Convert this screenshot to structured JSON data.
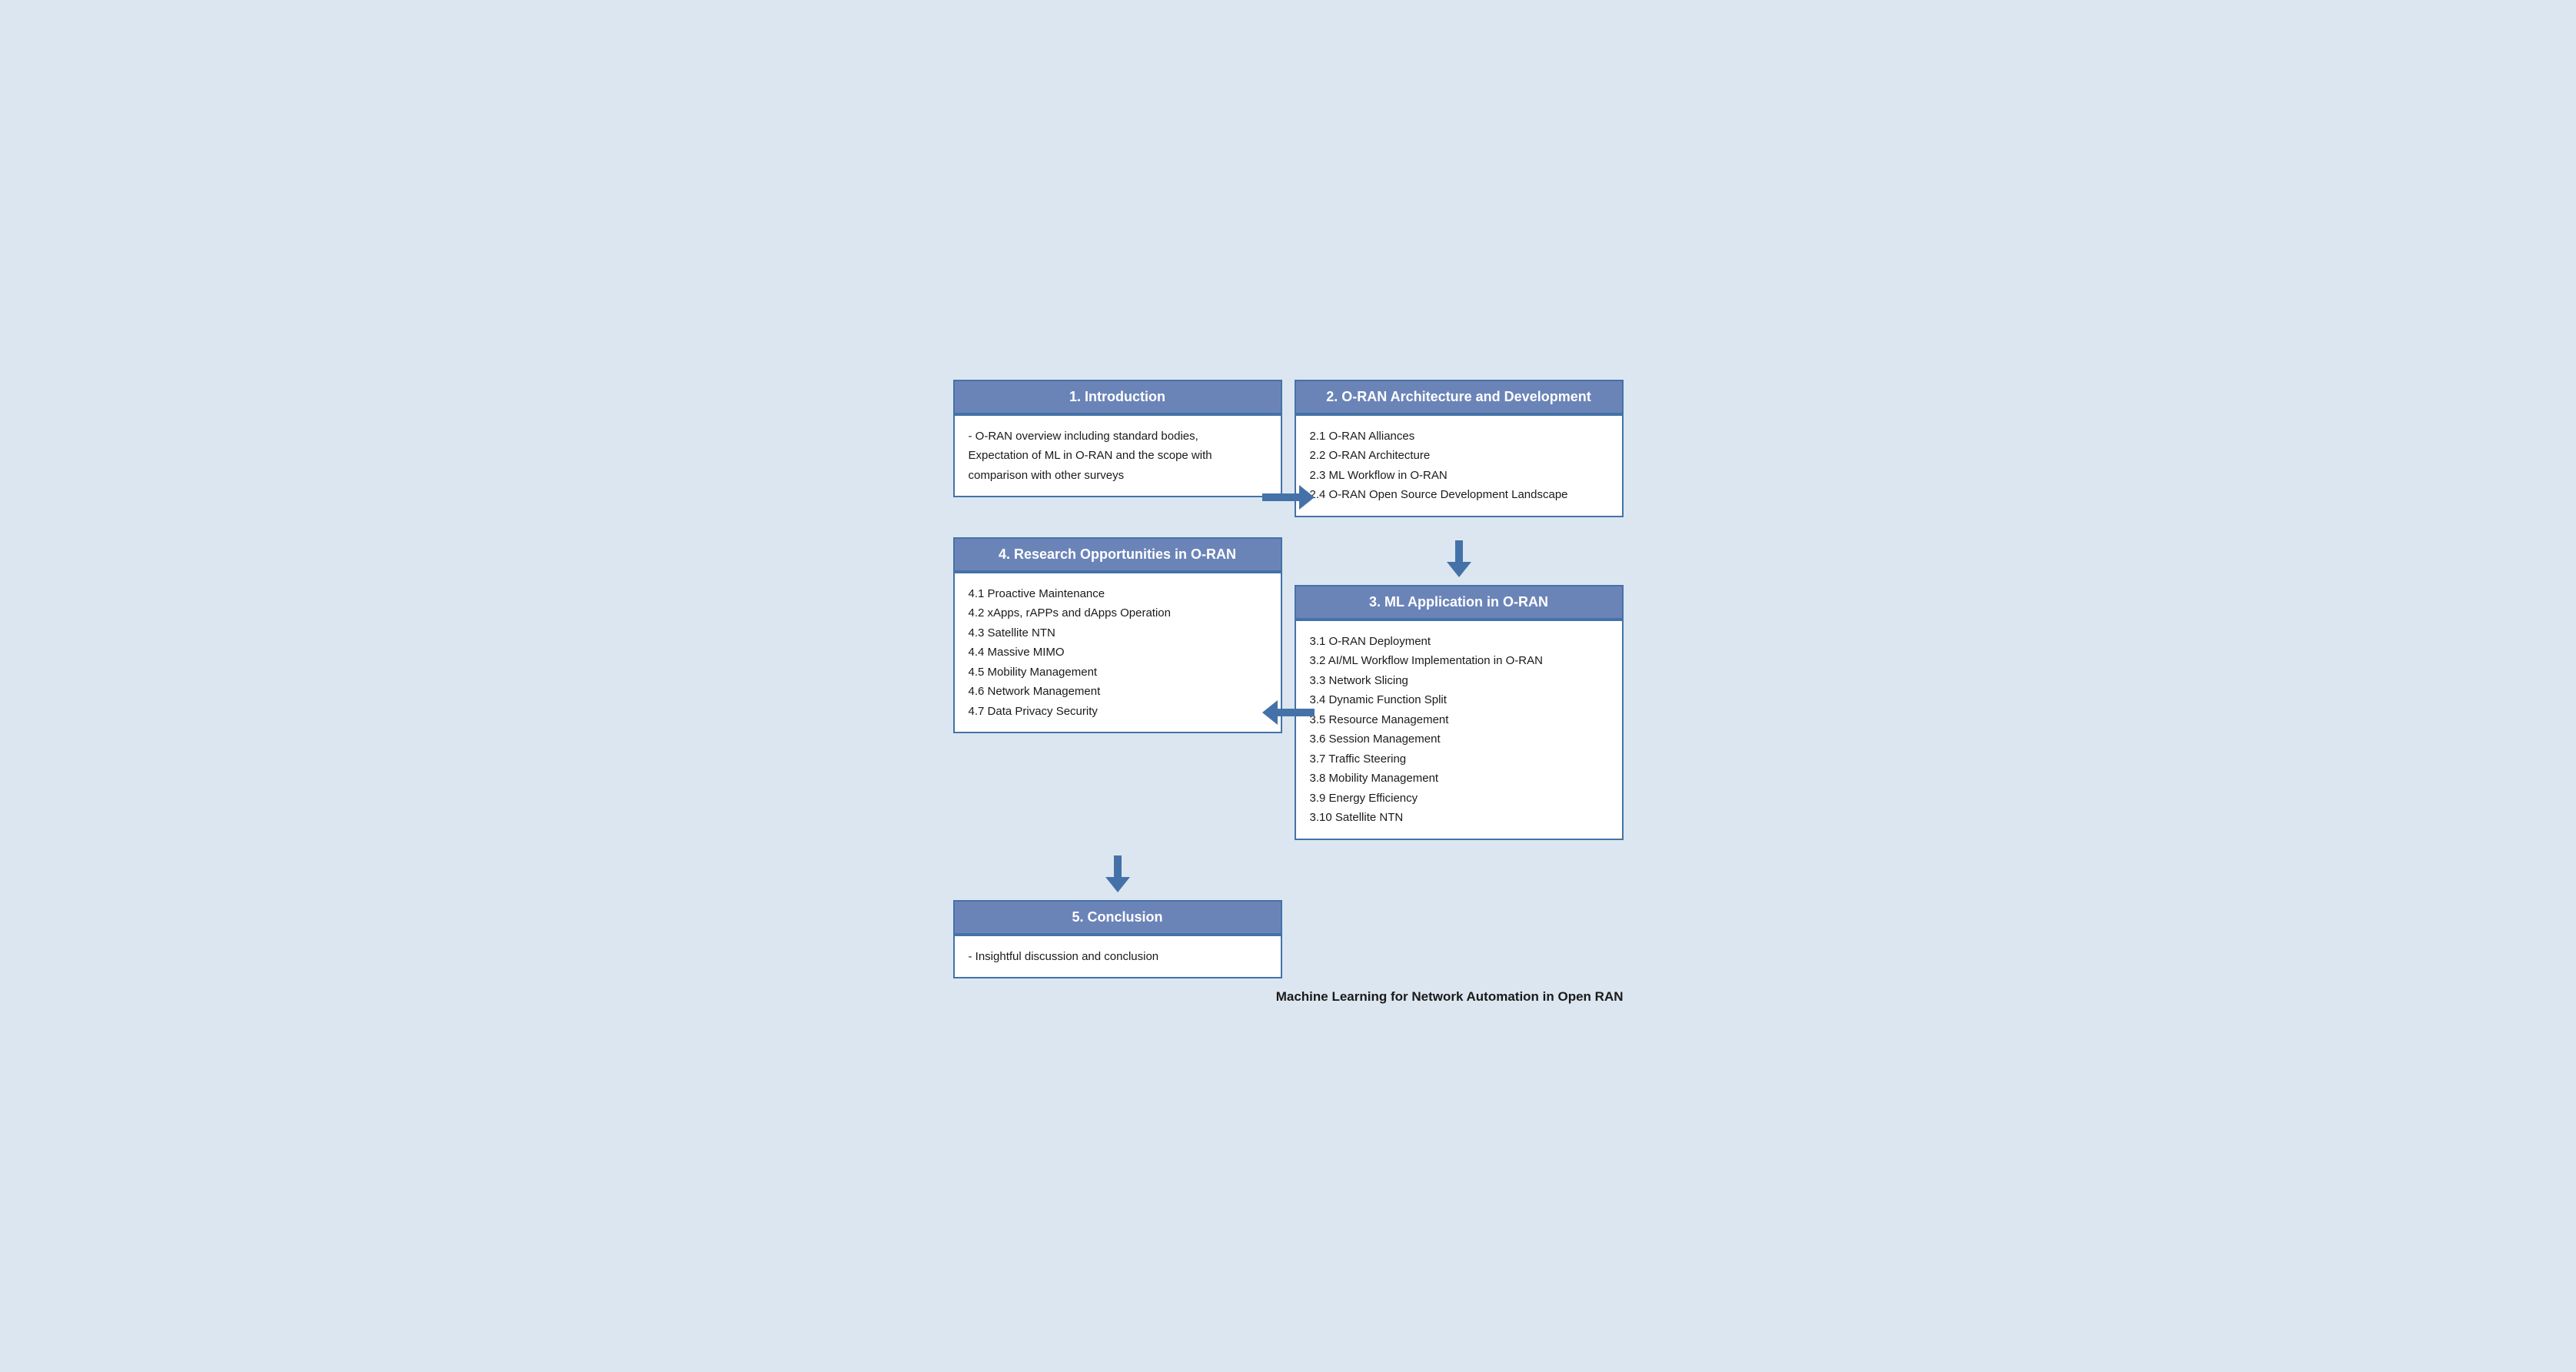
{
  "diagram": {
    "background_color": "#dce6f0",
    "border_color": "#4472a8",
    "header_bg": "#6b84b8",
    "sec1": {
      "title": "1.  Introduction",
      "body": "- O-RAN overview including standard bodies,\n  Expectation of ML in O-RAN and the scope with\n  comparison with other surveys"
    },
    "sec2": {
      "title": "2.  O-RAN Architecture and Development",
      "items": [
        "2.1  O-RAN Alliances",
        "2.2  O-RAN Architecture",
        "2.3  ML Workflow in O-RAN",
        "2.4  O-RAN Open Source Development Landscape"
      ]
    },
    "sec3": {
      "title": "3.  ML Application in O-RAN",
      "items": [
        "3.1  O-RAN Deployment",
        "3.2  AI/ML Workflow Implementation in O-RAN",
        "3.3  Network Slicing",
        "3.4  Dynamic Function Split",
        "3.5  Resource Management",
        "3.6  Session Management",
        "3.7  Traffic Steering",
        "3.8  Mobility Management",
        "3.9  Energy Efficiency",
        "3.10  Satellite NTN"
      ]
    },
    "sec4": {
      "title": "4.  Research Opportunities in O-RAN",
      "items": [
        "4.1  Proactive Maintenance",
        "4.2  xApps, rAPPs and dApps Operation",
        "4.3  Satellite NTN",
        "4.4  Massive MIMO",
        "4.5  Mobility Management",
        "4.6  Network Management",
        "4.7  Data Privacy Security"
      ]
    },
    "sec5": {
      "title": "5.  Conclusion",
      "body": "- Insightful discussion and conclusion"
    },
    "footer": "Machine Learning for Network Automation in Open RAN"
  }
}
